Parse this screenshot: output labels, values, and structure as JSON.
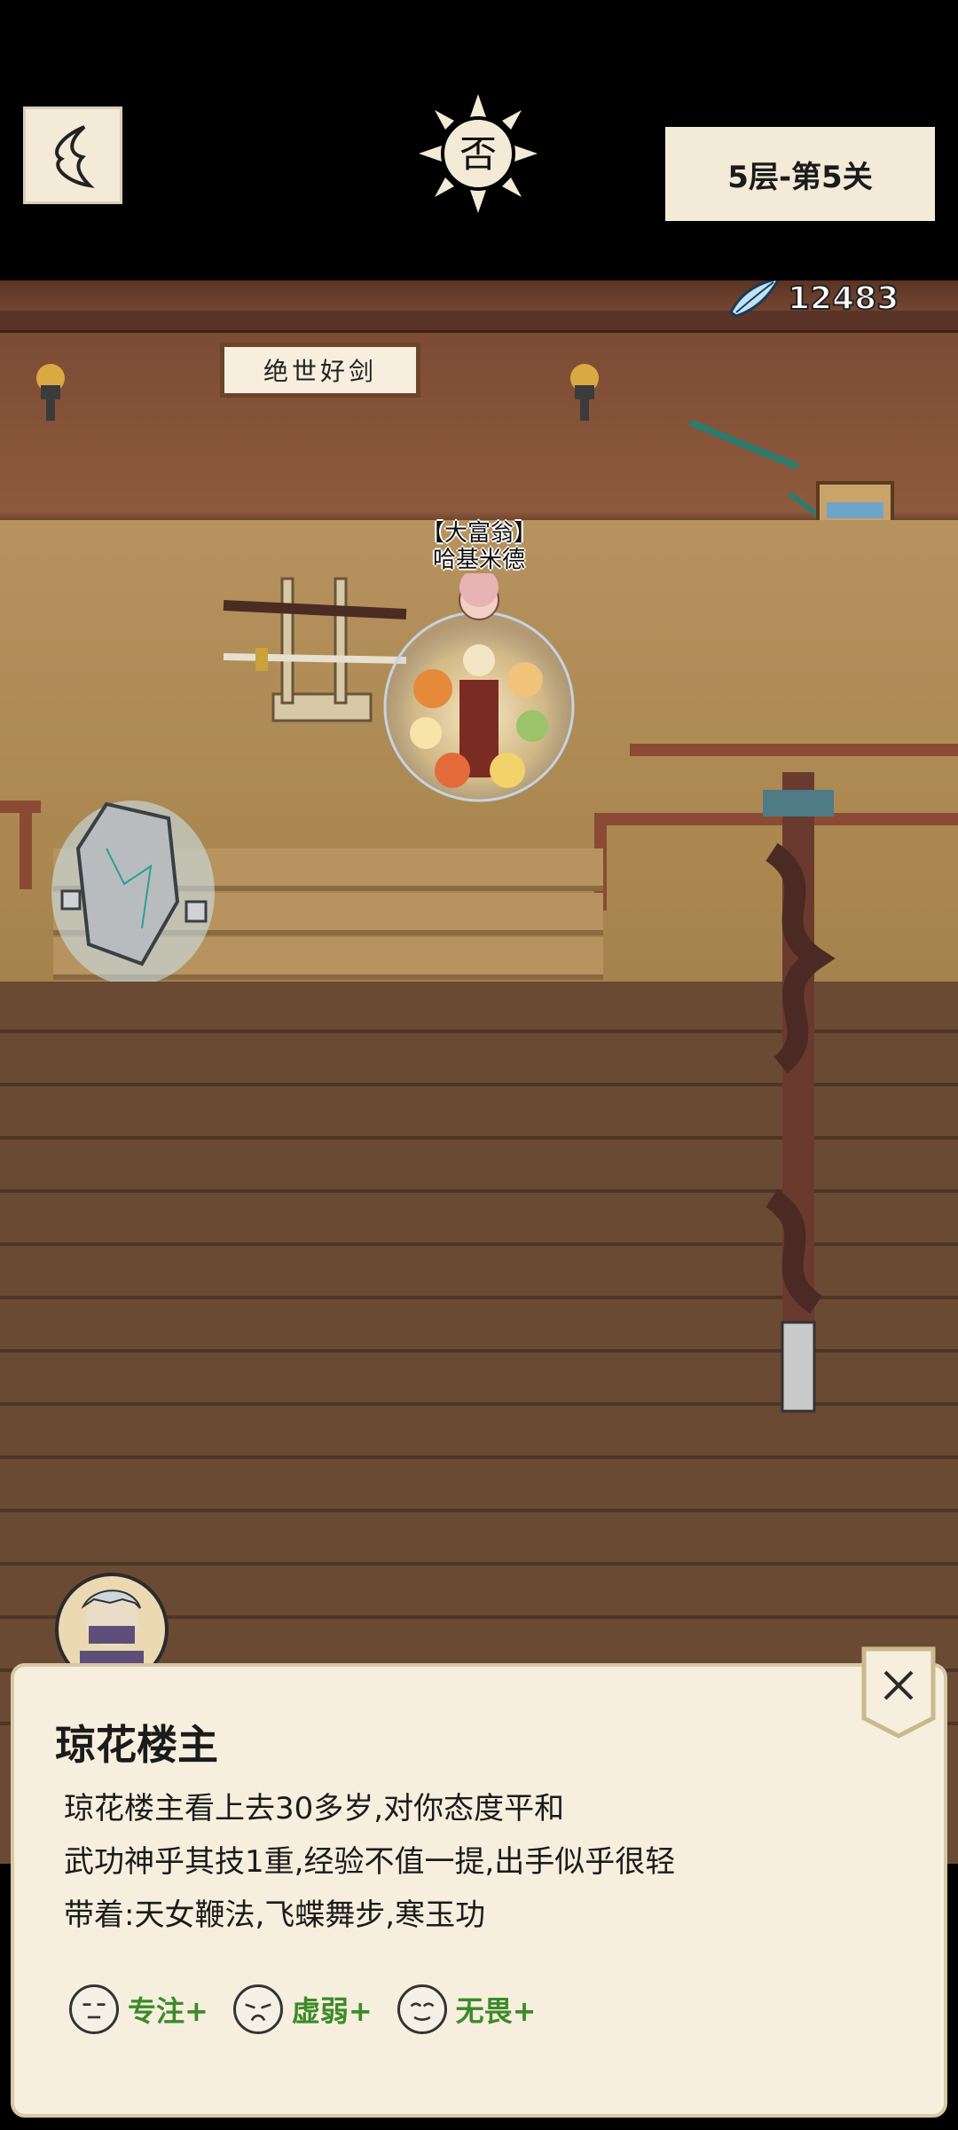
{
  "header": {
    "level": "5层-第5关",
    "emblem_char": "否"
  },
  "hud": {
    "currency_icon": "feather-icon",
    "currency_amount": "12483"
  },
  "scene": {
    "plaque_text": "绝世好剑",
    "npc": {
      "title": "【大富翁】",
      "name": "哈基米德"
    }
  },
  "dialog": {
    "title": "琼花楼主",
    "lines": [
      "琼花楼主看上去30多岁,对你态度平和",
      "武功神乎其技1重,经验不值一提,出手似乎很轻",
      "带着:天女鞭法,飞蝶舞步,寒玉功"
    ],
    "traits": [
      {
        "label": "专注+"
      },
      {
        "label": "虚弱+"
      },
      {
        "label": "无畏+"
      }
    ],
    "colors": {
      "trait_text": "#3c8a2a",
      "panel_bg": "#f7efdd"
    }
  }
}
